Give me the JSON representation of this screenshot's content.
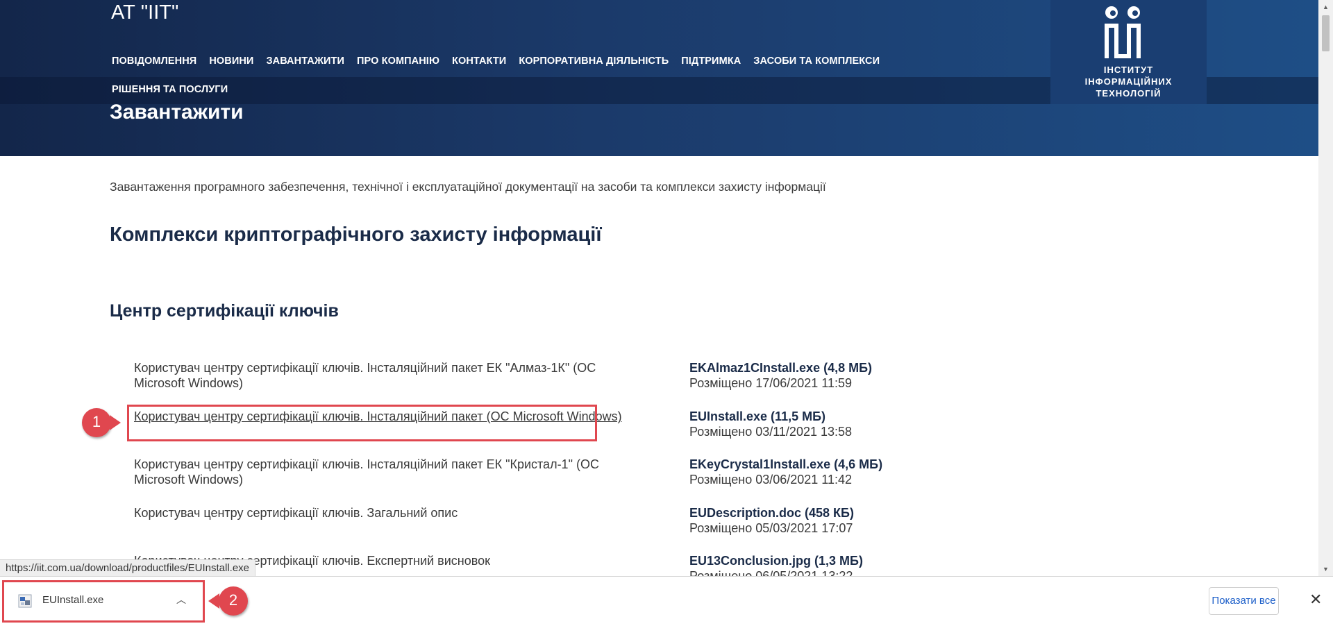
{
  "header": {
    "site_title": "АТ \"ІІТ\"",
    "nav": [
      "ПОВІДОМЛЕННЯ",
      "НОВИНИ",
      "ЗАВАНТАЖИТИ",
      "ПРО КОМПАНІЮ",
      "КОНТАКТИ",
      "КОРПОРАТИВНА ДІЯЛЬНІСТЬ",
      "ПІДТРИМКА",
      "ЗАСОБИ ТА КОМПЛЕКСИ",
      "РІШЕННЯ ТА ПОСЛУГИ"
    ],
    "page_heading": "Завантажити",
    "logo_lines": [
      "ІНСТИТУТ",
      "ІНФОРМАЦІЙНИХ",
      "ТЕХНОЛОГІЙ"
    ]
  },
  "main": {
    "intro": "Завантаження програмного забезпечення, технічної і експлуатаційної документації на засоби та комплекси захисту інформації",
    "section_title": "Комплекси криптографічного захисту інформації",
    "subsection_title": "Центр сертифікації ключів",
    "items": [
      {
        "description": "Користувач центру сертифікації ключів. Інсталяційний пакет ЕК \"Алмаз-1К\" (ОС Microsoft Windows)",
        "file": "EKAlmaz1CInstall.exe (4,8 МБ)",
        "posted": "Розміщено 17/06/2021 11:59"
      },
      {
        "description": "Користувач центру сертифікації ключів. Інсталяційний пакет (ОС Microsoft Windows)",
        "file": "EUInstall.exe (11,5 МБ)",
        "posted": "Розміщено 03/11/2021 13:58"
      },
      {
        "description": "Користувач центру сертифікації ключів. Інсталяційний пакет ЕК \"Кристал-1\" (ОС Microsoft Windows)",
        "file": "EKeyCrystal1Install.exe (4,6 МБ)",
        "posted": "Розміщено 03/06/2021 11:42"
      },
      {
        "description": "Користувач центру сертифікації ключів. Загальний опис",
        "file": "EUDescription.doc (458 КБ)",
        "posted": "Розміщено 05/03/2021 17:07"
      },
      {
        "description": "Користувач центру сертифікації ключів. Експертний висновок",
        "file": "EU13Conclusion.jpg (1,3 МБ)",
        "posted": "Розміщено 06/05/2021 13:22"
      }
    ]
  },
  "callouts": [
    "1",
    "2"
  ],
  "status_url": "https://iit.com.ua/download/productfiles/EUInstall.exe",
  "download_bar": {
    "file_name": "EUInstall.exe",
    "show_all": "Показати все"
  },
  "colors": {
    "header_dark": "#13264a",
    "header_light": "#1e4e86",
    "callout_red": "#e0474f",
    "link_blue": "#1a5dc8"
  }
}
